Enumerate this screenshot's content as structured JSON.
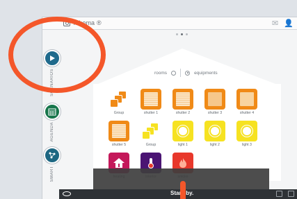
{
  "app": {
    "title": "Tahoma",
    "brand_suffix": "®"
  },
  "topbar": {
    "icons": [
      "mail-icon",
      "user-icon",
      "close-icon"
    ]
  },
  "pager": {
    "count": 3,
    "active": 1
  },
  "sidetabs": [
    {
      "id": "scenarios",
      "label": "SCENARIOS",
      "icon": "play-icon",
      "color": "#1f6a8c"
    },
    {
      "id": "agenda",
      "label": "AGENDA",
      "icon": "calendar-icon",
      "color": "#17754b"
    },
    {
      "id": "smart",
      "label": "SMART",
      "icon": "network-icon",
      "color": "#1d6782"
    }
  ],
  "view_toggle": {
    "rooms_label": "rooms",
    "equipments_label": "equipments",
    "selected": "equipments"
  },
  "devices": [
    {
      "label": "Group",
      "kind": "group",
      "color": "#f08a17"
    },
    {
      "label": "shutter 1",
      "kind": "shutter"
    },
    {
      "label": "shutter 2",
      "kind": "shutter"
    },
    {
      "label": "shutter 3",
      "kind": "shutter"
    },
    {
      "label": "shutter 4",
      "kind": "shutter"
    },
    {
      "label": "shutter 5",
      "kind": "shutter"
    },
    {
      "label": "Group",
      "kind": "group",
      "color": "#f6e221"
    },
    {
      "label": "light 1",
      "kind": "light"
    },
    {
      "label": "light 2",
      "kind": "light"
    },
    {
      "label": "light 3",
      "kind": "light"
    },
    {
      "label": "heating",
      "kind": "heating"
    },
    {
      "label": "interior",
      "kind": "interior"
    },
    {
      "label": "smoke",
      "kind": "smoke"
    }
  ],
  "footer": {
    "status": "Standby."
  },
  "colors": {
    "annotation": "#f4572a",
    "shutter": "#f08a17",
    "light": "#f6e221"
  }
}
